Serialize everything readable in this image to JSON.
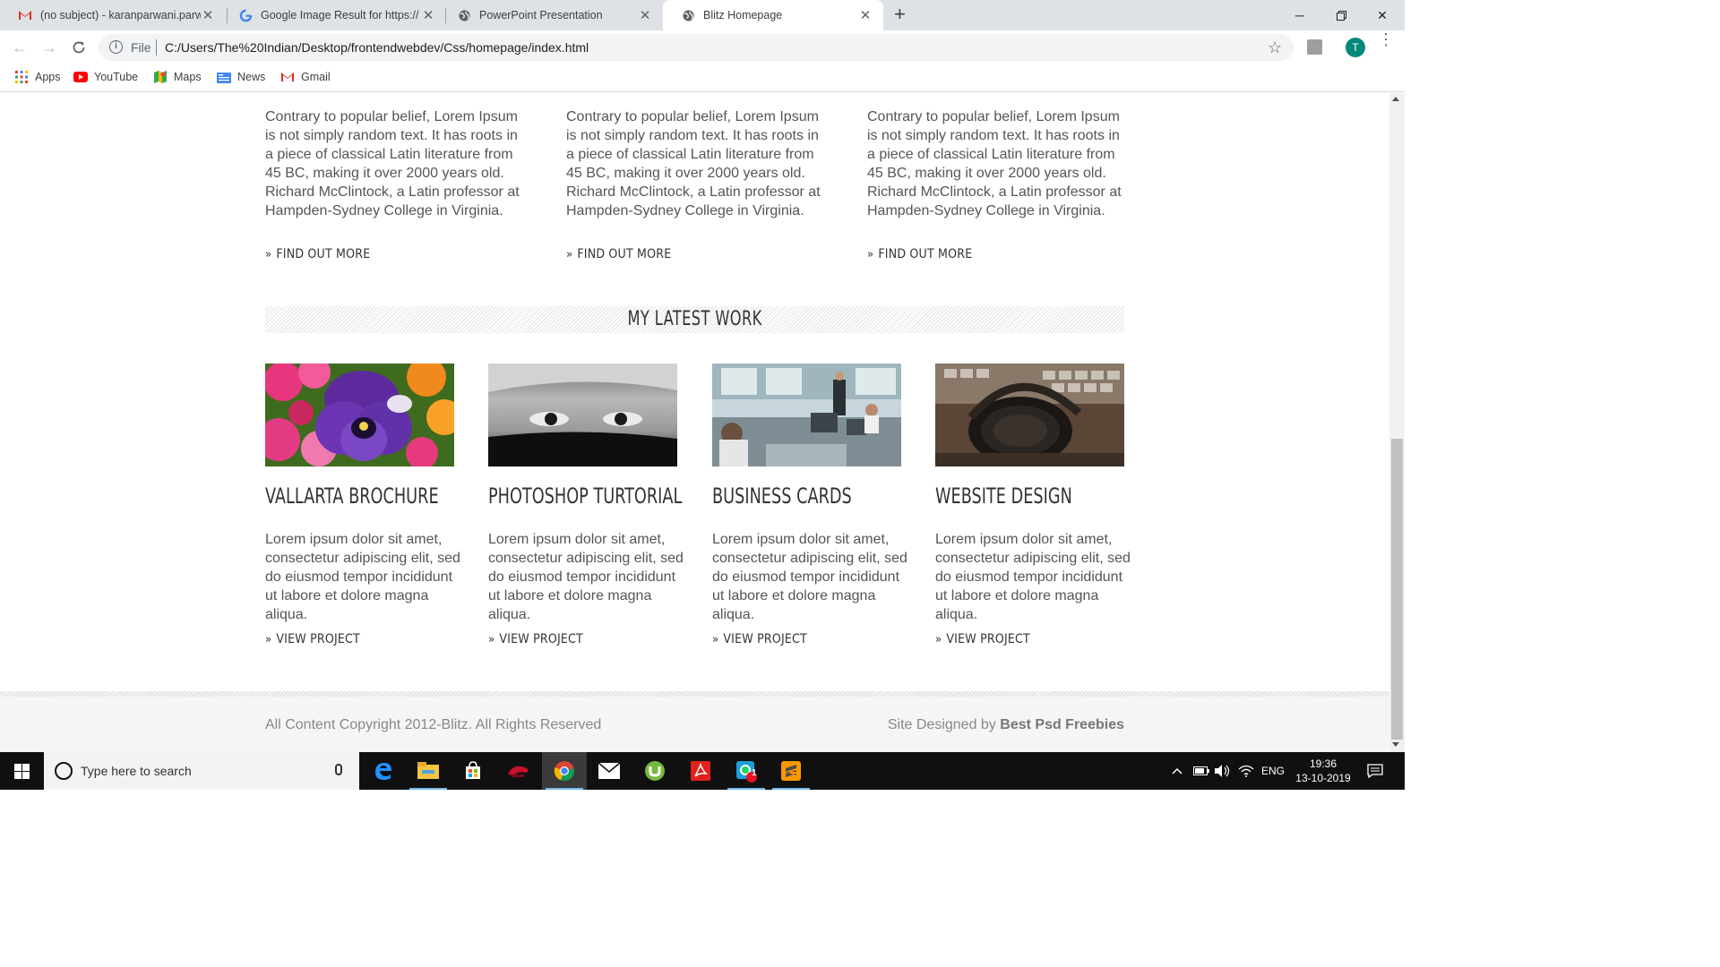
{
  "tabs": [
    {
      "title": "(no subject) - karanparwani.parw",
      "icon": "gmail-icon"
    },
    {
      "title": "Google Image Result for https://",
      "icon": "google-icon"
    },
    {
      "title": "PowerPoint Presentation",
      "icon": "globe-icon"
    },
    {
      "title": "Blitz Homepage",
      "icon": "globe-icon"
    }
  ],
  "toolbar": {
    "file_label": "File",
    "url": "C:/Users/The%20Indian/Desktop/frontendwebdev/Css/homepage/index.html",
    "avatar_letter": "T"
  },
  "bookmarks": [
    {
      "label": "Apps"
    },
    {
      "label": "YouTube"
    },
    {
      "label": "Maps"
    },
    {
      "label": "News"
    },
    {
      "label": "Gmail"
    }
  ],
  "page": {
    "columns": [
      {
        "text": "Contrary to popular belief, Lorem Ipsum is not simply random text. It has roots in a piece of classical Latin literature from 45 BC, making it over 2000 years old. Richard McClintock, a Latin professor at Hampden-Sydney College in Virginia.",
        "link": "FIND OUT MORE"
      },
      {
        "text": "Contrary to popular belief, Lorem Ipsum is not simply random text. It has roots in a piece of classical Latin literature from 45 BC, making it over 2000 years old. Richard McClintock, a Latin professor at Hampden-Sydney College in Virginia.",
        "link": "FIND OUT MORE"
      },
      {
        "text": "Contrary to popular belief, Lorem Ipsum is not simply random text. It has roots in a piece of classical Latin literature from 45 BC, making it over 2000 years old. Richard McClintock, a Latin professor at Hampden-Sydney College in Virginia.",
        "link": "FIND OUT MORE"
      }
    ],
    "section_title": "MY LATEST WORK",
    "works": [
      {
        "title": "VALLARTA BROCHURE",
        "desc": "Lorem ipsum dolor sit amet, consectetur adipiscing elit, sed do eiusmod tempor incididunt ut labore et dolore magna aliqua.",
        "link": "VIEW PROJECT"
      },
      {
        "title": "PHOTOSHOP TURTORIAL",
        "desc": "Lorem ipsum dolor sit amet, consectetur adipiscing elit, sed do eiusmod tempor incididunt ut labore et dolore magna aliqua.",
        "link": "VIEW PROJECT"
      },
      {
        "title": "BUSINESS CARDS",
        "desc": "Lorem ipsum dolor sit amet, consectetur adipiscing elit, sed do eiusmod tempor incididunt ut labore et dolore magna aliqua.",
        "link": "VIEW PROJECT"
      },
      {
        "title": "WEBSITE DESIGN",
        "desc": "Lorem ipsum dolor sit amet, consectetur adipiscing elit, sed do eiusmod tempor incididunt ut labore et dolore magna aliqua.",
        "link": "VIEW PROJECT"
      }
    ],
    "footer": {
      "copyright": "All Content Copyright 2012-Blitz. All Rights Reserved",
      "designed_prefix": "Site Designed by",
      "designed_by": "Best Psd Freebies"
    }
  },
  "taskbar": {
    "search_placeholder": "Type here to search",
    "language": "ENG",
    "time": "19:36",
    "date": "13-10-2019",
    "badge_count": "1"
  },
  "colors": {
    "chrome_bg": "#dee1e6",
    "avatar": "#00897b",
    "taskbar": "#101010"
  }
}
